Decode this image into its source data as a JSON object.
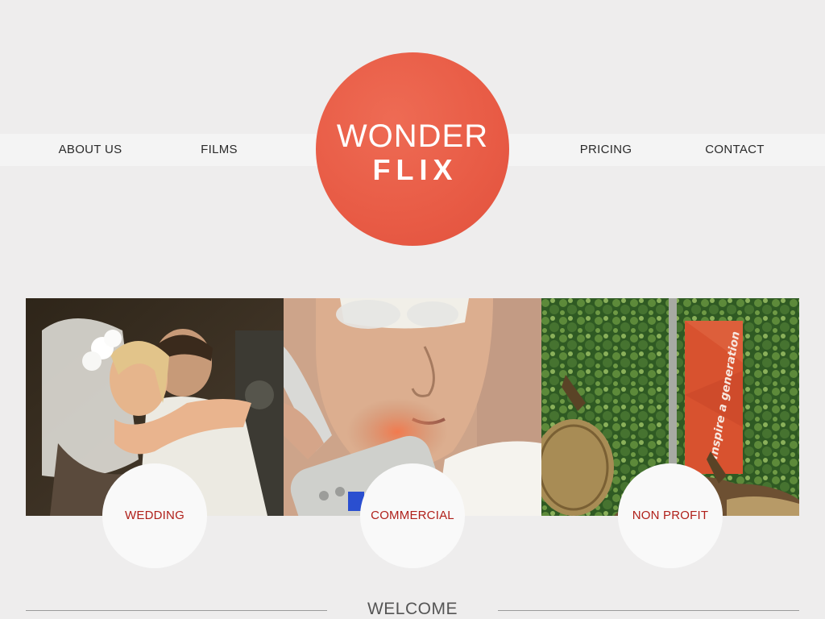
{
  "nav": {
    "left_items": [
      {
        "label": "ABOUT US"
      },
      {
        "label": "FILMS"
      }
    ],
    "right_items": [
      {
        "label": "PRICING"
      },
      {
        "label": "CONTACT"
      }
    ]
  },
  "logo": {
    "line1": "WONDER",
    "line2": "FLIX",
    "color": "#e85b45"
  },
  "categories": [
    {
      "label": "WEDDING",
      "image": "wedding-couple-photo"
    },
    {
      "label": "COMMERCIAL",
      "image": "facial-treatment-photo"
    },
    {
      "label": "NON PROFIT",
      "image": "banner-photo",
      "image_text": "Inspire a generation"
    }
  ],
  "welcome": {
    "heading": "WELCOME"
  },
  "colors": {
    "background": "#eeeded",
    "accent": "#e85b45",
    "category_label": "#b0201a"
  }
}
